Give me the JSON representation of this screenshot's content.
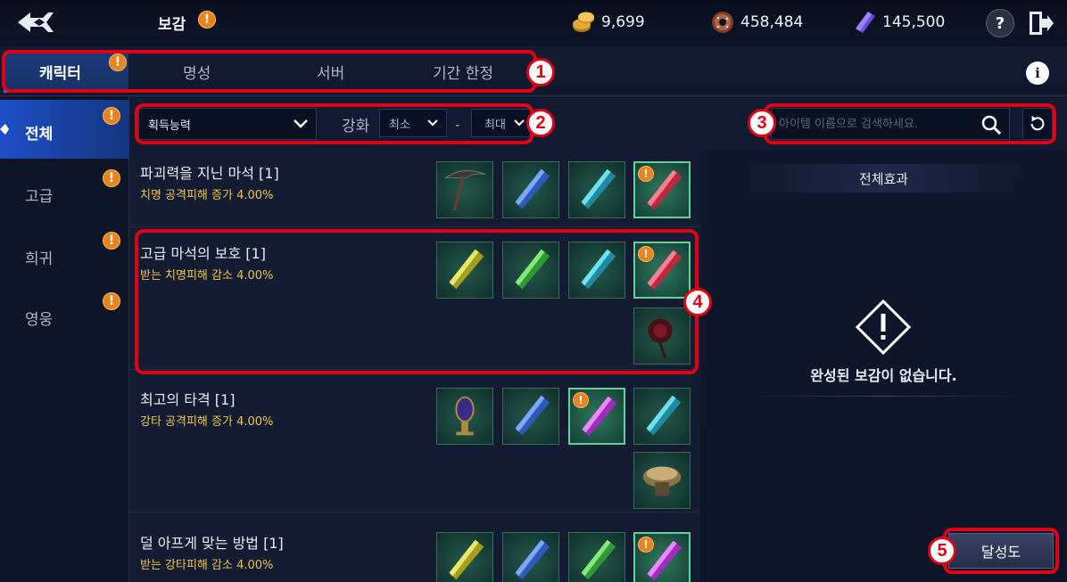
{
  "header": {
    "title": "보감",
    "currencies": [
      {
        "icon": "gold-coin-icon",
        "value": "9,699"
      },
      {
        "icon": "donut-token-icon",
        "value": "458,484"
      },
      {
        "icon": "purple-crystal-icon",
        "value": "145,500"
      }
    ],
    "help_label": "?"
  },
  "tabs": [
    {
      "label": "캐릭터",
      "active": true,
      "alert": true
    },
    {
      "label": "명성",
      "active": false
    },
    {
      "label": "서버",
      "active": false
    },
    {
      "label": "기간 한정",
      "active": false
    }
  ],
  "info_label": "i",
  "sidebar": {
    "items": [
      {
        "label": "전체",
        "active": true,
        "alert": true
      },
      {
        "label": "고급",
        "active": false,
        "alert": true
      },
      {
        "label": "희귀",
        "active": false,
        "alert": true
      },
      {
        "label": "영웅",
        "active": false,
        "alert": true
      }
    ]
  },
  "filters": {
    "ability_select": "획득능력",
    "enhance_label": "강화",
    "min_select": "최소",
    "dash": "-",
    "max_select": "최대",
    "search_placeholder": "아이템 이름으로 검색하세요."
  },
  "collections": [
    {
      "name": "파괴력을 지닌 마석 [1]",
      "effect": "치명 공격피해 증가 4.00%",
      "items": [
        {
          "icon": "pickaxe-icon",
          "owned": false,
          "alert": false
        },
        {
          "icon": "blue-crystal-icon",
          "owned": false,
          "alert": false
        },
        {
          "icon": "teal-crystal-icon",
          "owned": false,
          "alert": false
        },
        {
          "icon": "red-crystal-icon",
          "owned": true,
          "alert": true
        }
      ]
    },
    {
      "name": "고급 마석의 보호 [1]",
      "effect": "받는 치명피해 감소 4.00%",
      "items": [
        {
          "icon": "yellow-crystal-icon",
          "owned": false,
          "alert": false
        },
        {
          "icon": "green-crystal-icon",
          "owned": false,
          "alert": false
        },
        {
          "icon": "teal-crystal-icon",
          "owned": false,
          "alert": false
        },
        {
          "icon": "red-crystal-icon",
          "owned": true,
          "alert": true
        },
        {
          "icon": "dark-rose-icon",
          "owned": false,
          "alert": false
        }
      ]
    },
    {
      "name": "최고의 타격 [1]",
      "effect": "강타 공격피해 증가 4.00%",
      "items": [
        {
          "icon": "ornate-vase-icon",
          "owned": false,
          "alert": false
        },
        {
          "icon": "blue-crystal-icon",
          "owned": false,
          "alert": false
        },
        {
          "icon": "purple-crystal-icon",
          "owned": true,
          "alert": true
        },
        {
          "icon": "teal-crystal-icon",
          "owned": false,
          "alert": false
        },
        {
          "icon": "golden-fungus-icon",
          "owned": false,
          "alert": false
        }
      ]
    },
    {
      "name": "덜 아프게 맞는 방법 [1]",
      "effect": "받는 강타피해 감소 4.00%",
      "items": [
        {
          "icon": "yellow-crystal-icon",
          "owned": false,
          "alert": false
        },
        {
          "icon": "blue-crystal-icon",
          "owned": false,
          "alert": false
        },
        {
          "icon": "green-crystal-icon",
          "owned": false,
          "alert": false
        },
        {
          "icon": "purple-crystal-icon",
          "owned": true,
          "alert": true
        }
      ]
    }
  ],
  "right_panel": {
    "title": "전체효과",
    "empty_message": "완성된 보감이 없습니다."
  },
  "achievement_button": "달성도",
  "callouts": [
    "1",
    "2",
    "3",
    "4",
    "5"
  ],
  "colors": {
    "accent_blue": "#1d4fc5",
    "alert_orange": "#e8841e",
    "effect_gold": "#f0c44a",
    "callout_red": "#e00012"
  }
}
